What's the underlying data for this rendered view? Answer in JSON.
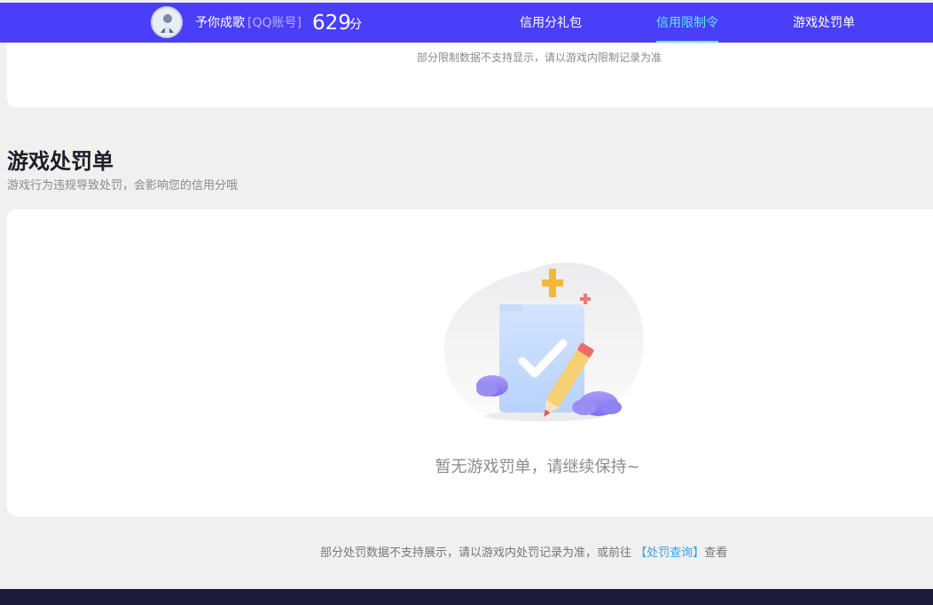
{
  "header": {
    "nickname": "予你成歌",
    "account_type": "[QQ账号]",
    "score": "629",
    "score_unit": "分",
    "nav": [
      {
        "label": "信用分礼包",
        "active": false
      },
      {
        "label": "信用限制令",
        "active": true
      },
      {
        "label": "游戏处罚单",
        "active": false
      }
    ]
  },
  "restriction": {
    "note": "部分限制数据不支持显示，请以游戏内限制记录为准"
  },
  "punishment": {
    "title": "游戏处罚单",
    "subtitle": "游戏行为违规导致处罚，会影响您的信用分哦",
    "empty_text": "暂无游戏罚单，请继续保持~",
    "note_prefix": "部分处罚数据不支持展示，请以游戏内处罚记录为准，或前往",
    "note_link": "【处罚查询】",
    "note_suffix": "查看"
  },
  "colors": {
    "header_bg": "#4a3ef8",
    "active_nav": "#5ee8ff",
    "link": "#3aa3e8",
    "footer_bg": "#1c1b3b"
  }
}
